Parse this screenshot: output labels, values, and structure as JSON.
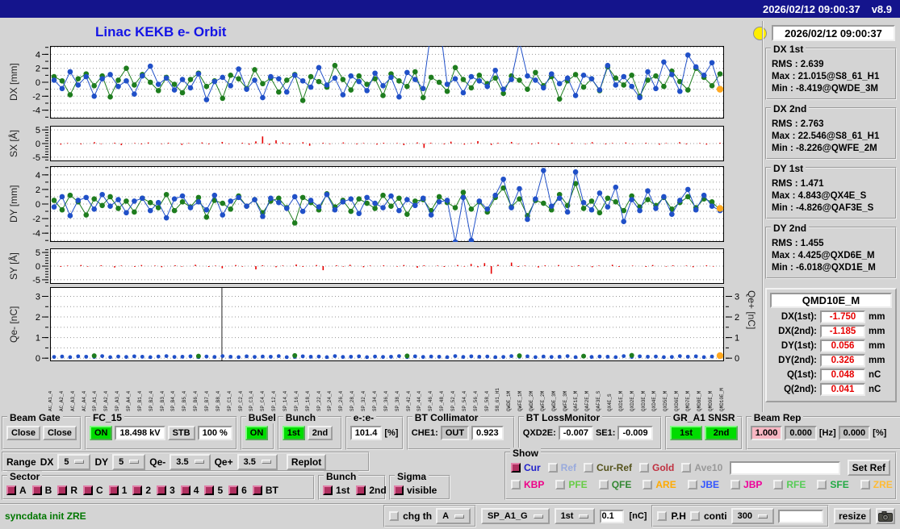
{
  "titlebar": {
    "datetime": "2026/02/12 09:00:37",
    "version": "v8.9"
  },
  "header": {
    "title": "Linac KEKB e- Orbit",
    "clock": "2026/02/12 09:00:37"
  },
  "plots": [
    {
      "id": "dx",
      "ylabel": "DX [mm]",
      "ylim": [
        -5.2,
        5.2
      ],
      "grid_step": 1,
      "minor_step": 1,
      "yticks": [
        4,
        2,
        0,
        -2,
        -4
      ],
      "type": "line",
      "series": [
        {
          "name": "green",
          "color": "#1e7d1e",
          "values": [
            0.8,
            0.2,
            -1.8,
            0.5,
            1.2,
            -0.5,
            0.9,
            -2.1,
            0.3,
            2.0,
            -0.4,
            1.1,
            0.0,
            -1.2,
            0.7,
            -0.3,
            -1.5,
            0.4,
            1.3,
            -0.6,
            0.2,
            -2.3,
            1.0,
            0.5,
            -0.9,
            1.8,
            -0.2,
            0.6,
            -1.4,
            0.3,
            1.1,
            -2.6,
            0.8,
            0.1,
            -0.7,
            2.4,
            0.4,
            -1.1,
            0.9,
            -0.3,
            0.5,
            -1.9,
            1.2,
            0.2,
            -0.6,
            1.5,
            -2.2,
            0.7,
            0.0,
            -1.3,
            2.1,
            0.4,
            -0.8,
            1.0,
            -0.2,
            0.6,
            -1.6,
            0.9,
            0.3,
            -1.0,
            1.4,
            -0.5,
            0.8,
            -2.4,
            0.2,
            1.1,
            -0.7,
            0.5,
            -1.2,
            2.2,
            0.6,
            -0.4,
            1.0,
            -2.0,
            0.3,
            0.9,
            -0.6,
            1.6,
            0.1,
            -1.1,
            2.0,
            0.7,
            -0.5,
            1.2
          ]
        },
        {
          "name": "blue",
          "color": "#2050c8",
          "values": [
            0.3,
            -0.9,
            1.5,
            -0.4,
            0.8,
            -2.0,
            0.5,
            1.1,
            -0.6,
            0.2,
            -1.7,
            0.9,
            2.3,
            -0.3,
            0.6,
            -1.1,
            0.4,
            -0.8,
            1.2,
            -2.5,
            0.1,
            0.7,
            -0.5,
            1.9,
            -1.0,
            0.3,
            -2.2,
            0.8,
            0.5,
            -1.4,
            1.0,
            0.2,
            -0.7,
            2.1,
            -0.4,
            0.6,
            -1.8,
            0.9,
            0.1,
            -1.2,
            1.3,
            -0.5,
            0.7,
            -2.1,
            1.4,
            0.4,
            -0.9,
            7.5,
            9.0,
            -0.3,
            0.5,
            -1.5,
            0.8,
            0.2,
            -0.6,
            1.7,
            -1.0,
            0.4,
            5.8,
            0.9,
            0.3,
            -0.8,
            1.2,
            -0.2,
            0.6,
            -1.9,
            1.0,
            0.5,
            -1.1,
            2.4,
            -0.4,
            0.8,
            -0.6,
            -2.2,
            1.5,
            -0.9,
            2.9,
            1.1,
            -1.3,
            3.9,
            2.2,
            1.0,
            2.8,
            -0.9
          ]
        }
      ],
      "end_marker": {
        "value": -1.0,
        "color": "#ffa820"
      }
    },
    {
      "id": "sx",
      "ylabel": "SX [Å]",
      "ylim": [
        -6.5,
        6.5
      ],
      "grid_step": 5,
      "minor_step": 1,
      "yticks": [
        5,
        0,
        -5
      ],
      "type": "stem",
      "color": "#e60000",
      "values": [
        0,
        -0.4,
        0.2,
        0,
        -0.3,
        0,
        0.5,
        -0.2,
        0,
        0.3,
        -0.6,
        0,
        0.2,
        -0.3,
        0.4,
        0,
        -0.2,
        0.3,
        0,
        -0.5,
        0.2,
        0,
        0.4,
        -0.3,
        0,
        0.6,
        -0.2,
        0,
        0.3,
        -0.4,
        0.8,
        2.6,
        -0.5,
        1.2,
        0.4,
        -0.3,
        0,
        0.5,
        -0.8,
        0,
        0.3,
        -0.2,
        0,
        0.4,
        0,
        -0.3,
        0.2,
        0,
        -0.4,
        0.3,
        0,
        0.2,
        -0.6,
        0,
        0.4,
        -1.6,
        0.3,
        0,
        -0.3,
        0.7,
        0,
        -0.4,
        0.2,
        0.9,
        0,
        -0.5,
        0.3,
        0,
        0.6,
        -0.2,
        0,
        -0.3,
        0.4,
        0,
        0.2,
        -0.4,
        0,
        0.3,
        0,
        -0.2,
        0.5,
        0,
        -0.3,
        0.2,
        0,
        0.4,
        -0.2,
        0,
        0.3,
        0,
        -0.4,
        0.2,
        0,
        0.5,
        -0.3,
        0,
        0.2,
        -0.4,
        0,
        0.3
      ]
    },
    {
      "id": "dy",
      "ylabel": "DY [mm]",
      "ylim": [
        -5.2,
        5.2
      ],
      "grid_step": 1,
      "minor_step": 1,
      "yticks": [
        4,
        2,
        0,
        -2,
        -4
      ],
      "type": "line",
      "series": [
        {
          "name": "green",
          "color": "#1e7d1e",
          "values": [
            0.5,
            -0.8,
            1.2,
            0.3,
            -1.5,
            0.7,
            -0.2,
            1.0,
            -0.6,
            0.4,
            -1.1,
            0.8,
            0.2,
            -0.5,
            1.3,
            -0.9,
            0.3,
            -0.4,
            0.9,
            -1.8,
            0.5,
            0.1,
            -0.7,
            1.1,
            -0.3,
            0.6,
            -1.2,
            0.4,
            0.8,
            -0.5,
            -2.6,
            0.9,
            0.2,
            -0.8,
            1.4,
            -0.4,
            0.5,
            -1.0,
            0.7,
            0.1,
            -0.6,
            1.2,
            -0.3,
            0.8,
            -1.4,
            0.4,
            0.6,
            -0.9,
            1.0,
            0.2,
            -0.5,
            1.6,
            -0.7,
            0.3,
            -1.1,
            0.9,
            2.2,
            -0.4,
            0.7,
            -1.6,
            0.5,
            0.1,
            -0.8,
            1.3,
            -0.2,
            2.8,
            -0.6,
            0.4,
            -1.2,
            0.8,
            0.3,
            -0.9,
            1.1,
            -0.4,
            0.6,
            -0.2,
            0.9,
            -0.7,
            0.2,
            1.0,
            -0.5,
            0.7,
            0.3,
            -0.8
          ]
        },
        {
          "name": "blue",
          "color": "#2050c8",
          "values": [
            -0.4,
            1.0,
            -1.6,
            0.5,
            0.9,
            -0.7,
            1.3,
            -0.3,
            0.6,
            -1.2,
            0.4,
            0.8,
            -0.9,
            0.2,
            -1.9,
            0.7,
            1.1,
            -0.5,
            0.3,
            -0.8,
            1.2,
            -1.5,
            0.4,
            0.9,
            -0.3,
            0.6,
            -1.7,
            0.8,
            0.2,
            -0.6,
            1.0,
            -1.0,
            0.5,
            -0.4,
            1.3,
            -0.8,
            0.3,
            0.7,
            -1.3,
            0.9,
            0.1,
            -0.5,
            1.1,
            -0.9,
            0.6,
            -0.2,
            0.8,
            -1.5,
            0.3,
            0.5,
            -5.2,
            0.9,
            -5.0,
            0.4,
            -0.7,
            1.2,
            3.4,
            -0.5,
            2.1,
            -2.1,
            0.7,
            4.6,
            -0.3,
            0.8,
            -1.1,
            4.4,
            0.2,
            -0.8,
            1.5,
            -0.4,
            2.3,
            -2.4,
            0.6,
            -0.9,
            1.8,
            -0.6,
            1.0,
            -1.4,
            0.5,
            2.0,
            -0.8,
            1.2,
            -0.3,
            -0.9
          ]
        }
      ],
      "end_marker": {
        "value": -0.6,
        "color": "#ffa820"
      }
    },
    {
      "id": "sy",
      "ylabel": "SY [Å]",
      "ylim": [
        -6.5,
        6.5
      ],
      "grid_step": 5,
      "minor_step": 1,
      "yticks": [
        5,
        0,
        -5
      ],
      "type": "stem",
      "color": "#e60000",
      "values": [
        0,
        -0.3,
        0.2,
        0,
        0.4,
        -0.2,
        0,
        0.3,
        0,
        -0.5,
        0.2,
        0,
        -0.3,
        0.4,
        0,
        0.2,
        -0.4,
        0,
        0.3,
        -0.2,
        0,
        0.5,
        0,
        -0.3,
        0.2,
        -0.8,
        0,
        0.4,
        -0.2,
        0,
        -1.2,
        0.3,
        0,
        -0.4,
        0.2,
        0,
        0.6,
        -0.3,
        0,
        0.4,
        -1.5,
        0,
        0.3,
        -0.2,
        0.5,
        0,
        -0.4,
        0.2,
        0,
        0.3,
        0,
        -0.2,
        0.4,
        0,
        -0.6,
        0.3,
        0,
        0.2,
        -0.3,
        0,
        0.4,
        -0.2,
        0.8,
        -0.4,
        1.1,
        -2.8,
        0.5,
        0,
        1.3,
        -0.3,
        0.2,
        0,
        -0.5,
        0.3,
        0,
        0.4,
        0,
        -0.2,
        0.3,
        0,
        -0.4,
        0.2,
        0,
        0.5,
        -0.3,
        0,
        0.2,
        0,
        -0.3,
        0.4,
        0,
        -0.2,
        0.3,
        0,
        0.2,
        -0.4,
        0,
        0.3,
        -0.2,
        0
      ]
    },
    {
      "id": "qe",
      "ylabel": "Qe- [nC]",
      "ylabel_right": "Qe+ [nC]",
      "ylim": [
        -0.15,
        3.45
      ],
      "grid_step": 0.5,
      "minor_step": 0.5,
      "yticks": [
        3,
        2,
        1,
        0
      ],
      "right_axis": true,
      "type": "scatter",
      "spike_at": 0.255,
      "series": [
        {
          "name": "blue",
          "color": "#2050c8",
          "values": [
            0.06,
            0.08,
            0.05,
            0.09,
            0.07,
            0.06,
            0.1,
            0.05,
            0.08,
            0.06,
            0.09,
            0.07,
            0.05,
            0.08,
            0.1,
            0.06,
            0.07,
            0.09,
            0.05,
            0.08,
            0.06,
            0.1,
            0.07,
            0.05,
            0.09,
            0.06,
            0.08,
            0.07,
            0.1,
            0.05,
            0.06,
            0.09,
            0.07,
            0.08,
            0.05,
            0.1,
            0.06,
            0.07,
            0.09,
            0.05,
            0.08,
            0.06,
            0.07,
            0.1,
            0.05,
            0.09,
            0.06,
            0.08,
            0.07,
            0.05,
            0.1,
            0.06,
            0.09,
            0.07,
            0.08,
            0.05,
            0.06,
            0.1,
            0.07,
            0.09,
            0.05,
            0.08,
            0.06,
            0.07,
            0.1,
            0.05,
            0.09,
            0.06,
            0.08,
            0.07,
            0.05,
            0.1,
            0.06,
            0.09,
            0.07,
            0.08,
            0.05,
            0.06,
            0.1,
            0.07,
            0.09,
            0.05,
            0.08,
            0.15
          ]
        },
        {
          "name": "green",
          "color": "#1e7d1e",
          "points": [
            [
              5,
              0.12
            ],
            [
              18,
              0.1
            ],
            [
              30,
              0.13
            ],
            [
              44,
              0.11
            ],
            [
              58,
              0.12
            ],
            [
              66,
              0.1
            ],
            [
              72,
              0.14
            ]
          ]
        }
      ],
      "end_marker": {
        "value": 0.12,
        "color": "#ffa820"
      }
    }
  ],
  "xaxis_labels": [
    "AC_A1_4",
    "AC_A2_4",
    "AC_A3_4",
    "AC_A4_4",
    "SP_A1_4",
    "SP_A2_4",
    "SP_A3_4",
    "SP_A4_4",
    "SP_B1_4",
    "SP_B2_4",
    "SP_B3_4",
    "SP_B4_4",
    "SP_B5_4",
    "SP_B6_4",
    "SP_B7_4",
    "SP_B8_4",
    "SP_C1_4",
    "SP_C2_4",
    "SP_C3_4",
    "SP_C4_4",
    "SP_12_4",
    "SP_14_4",
    "SP_16_4",
    "SP_18_4",
    "SP_22_4",
    "SP_24_4",
    "SP_26_4",
    "SP_28_4",
    "SP_32_4",
    "SP_34_4",
    "SP_36_4",
    "SP_38_4",
    "SP_42_4",
    "SP_44_4",
    "SP_46_4",
    "SP_48_4",
    "SP_52_4",
    "SP_54_4",
    "SP_56_4",
    "SP_58_4",
    "S8_61_H1",
    "QWDE_1M",
    "QWFE_1M",
    "QWDE_2M",
    "QWFE_2M",
    "QWDE_3M",
    "QWFE_3M",
    "QAF1E_M",
    "QAF2E_M",
    "QAF3E_S",
    "QX4E_S",
    "QXD1E_M",
    "QXD2E_M",
    "QXD3E_M",
    "QXD4E_M",
    "QXD5E_M",
    "QXD6E_M",
    "QMD7E_M",
    "QMD8E_M",
    "QMD9E_M",
    "QMD10E_M"
  ],
  "stats": [
    {
      "title": "DX 1st",
      "rows": [
        {
          "label": "RMS :",
          "value": "2.639"
        },
        {
          "label": "Max :",
          "value": "21.015@S8_61_H1"
        },
        {
          "label": "Min :",
          "value": "-8.419@QWDE_3M"
        }
      ]
    },
    {
      "title": "DX 2nd",
      "rows": [
        {
          "label": "RMS :",
          "value": "2.763"
        },
        {
          "label": "Max :",
          "value": "22.546@S8_61_H1"
        },
        {
          "label": "Min :",
          "value": "-8.226@QWFE_2M"
        }
      ]
    },
    {
      "title": "DY 1st",
      "rows": [
        {
          "label": "RMS :",
          "value": "1.471"
        },
        {
          "label": "Max :",
          "value": "4.843@QX4E_S"
        },
        {
          "label": "Min :",
          "value": "-4.826@QAF3E_S"
        }
      ]
    },
    {
      "title": "DY 2nd",
      "rows": [
        {
          "label": "RMS :",
          "value": "1.455"
        },
        {
          "label": "Max :",
          "value": "4.425@QXD6E_M"
        },
        {
          "label": "Min :",
          "value": "-6.018@QXD1E_M"
        }
      ]
    }
  ],
  "monitor": {
    "title": "QMD10E_M",
    "rows": [
      {
        "label": "DX(1st):",
        "value": "-1.750",
        "unit": "mm"
      },
      {
        "label": "DX(2nd):",
        "value": "-1.185",
        "unit": "mm"
      },
      {
        "label": "DY(1st):",
        "value": "0.056",
        "unit": "mm"
      },
      {
        "label": "DY(2nd):",
        "value": "0.326",
        "unit": "mm"
      },
      {
        "label": "Q(1st):",
        "value": "0.048",
        "unit": "nC"
      },
      {
        "label": "Q(2nd):",
        "value": "0.041",
        "unit": "nC"
      }
    ]
  },
  "controls": {
    "beam_gate": {
      "label": "Beam Gate",
      "btn1": "Close",
      "btn2": "Close"
    },
    "fc15": {
      "label": "FC_15",
      "on": "ON",
      "kv": "18.498 kV",
      "stb": "STB",
      "percent": "100 %"
    },
    "busel": {
      "label": "BuSel",
      "on": "ON"
    },
    "bunch": {
      "label": "Bunch",
      "first": "1st",
      "second": "2nd"
    },
    "ee": {
      "label": "e-:e-",
      "value": "101.4",
      "unit": "[%]"
    },
    "bt_collimator": {
      "label": "BT Collimator",
      "che1_label": "CHE1:",
      "che1_state": "OUT",
      "che1_value": "0.923"
    },
    "bt_lossmonitor": {
      "label": "BT LossMonitor",
      "qxd2e_label": "QXD2E:",
      "qxd2e": "-0.007",
      "se1_label": "SE1:",
      "se1": "-0.009"
    },
    "gr_a1": {
      "label": "GR_A1 SNSR",
      "first": "1st",
      "second": "2nd"
    },
    "beam_rep": {
      "label": "Beam Rep",
      "v1": "1.000",
      "v2": "0.000",
      "hz": "[Hz]",
      "v3": "0.000",
      "pct": "[%]"
    }
  },
  "range_row": {
    "label": "Range",
    "dx_label": "DX",
    "dx": "5",
    "dy_label": "DY",
    "dy": "5",
    "qem_label": "Qe-",
    "qem": "3.5",
    "qep_label": "Qe+",
    "qep": "3.5",
    "replot": "Replot"
  },
  "sector": {
    "label": "Sector",
    "items": [
      {
        "label": "A",
        "checked": true
      },
      {
        "label": "B",
        "checked": true
      },
      {
        "label": "R",
        "checked": true
      },
      {
        "label": "C",
        "checked": true
      },
      {
        "label": "1",
        "checked": true
      },
      {
        "label": "2",
        "checked": true
      },
      {
        "label": "3",
        "checked": true
      },
      {
        "label": "4",
        "checked": true
      },
      {
        "label": "5",
        "checked": true
      },
      {
        "label": "6",
        "checked": true
      },
      {
        "label": "BT",
        "checked": true
      }
    ]
  },
  "bunch_sel": {
    "label": "Bunch",
    "items": [
      {
        "label": "1st",
        "checked": true
      },
      {
        "label": "2nd",
        "checked": true
      }
    ]
  },
  "sigma": {
    "label": "Sigma",
    "item": {
      "label": "visible",
      "checked": true
    }
  },
  "show": {
    "label": "Show",
    "row1": [
      {
        "label": "Cur",
        "color": "#2222cc",
        "checked": true
      },
      {
        "label": "Ref",
        "color": "#99aadd",
        "checked": false
      },
      {
        "label": "Cur-Ref",
        "color": "#55531c",
        "checked": false
      },
      {
        "label": "Gold",
        "color": "#c03040",
        "checked": false
      },
      {
        "label": "Ave10",
        "color": "#999999",
        "checked": false
      }
    ],
    "ref_input": "",
    "set_ref": "Set Ref",
    "row2": [
      {
        "label": "KBP",
        "color": "#ee0088",
        "checked": false
      },
      {
        "label": "PFE",
        "color": "#66cc44",
        "checked": false
      },
      {
        "label": "QFE",
        "color": "#338833",
        "checked": false
      },
      {
        "label": "ARE",
        "color": "#ffaa00",
        "checked": false
      },
      {
        "label": "JBE",
        "color": "#3355ff",
        "checked": false
      },
      {
        "label": "JBP",
        "color": "#ee0099",
        "checked": false
      },
      {
        "label": "RFE",
        "color": "#55cc55",
        "checked": false
      },
      {
        "label": "SFE",
        "color": "#22aa44",
        "checked": false
      },
      {
        "label": "ZRE",
        "color": "#ffbb33",
        "checked": false
      }
    ]
  },
  "statusbar": {
    "message": "syncdata init ZRE",
    "chg_th": "chg th",
    "chg_sel": "A",
    "sp": "SP_A1_G",
    "bunch": "1st",
    "threshold": "0.1",
    "unit": "[nC]",
    "ph": "P.H",
    "conti": "conti",
    "points": "300",
    "extra_input": "",
    "resize": "resize"
  }
}
